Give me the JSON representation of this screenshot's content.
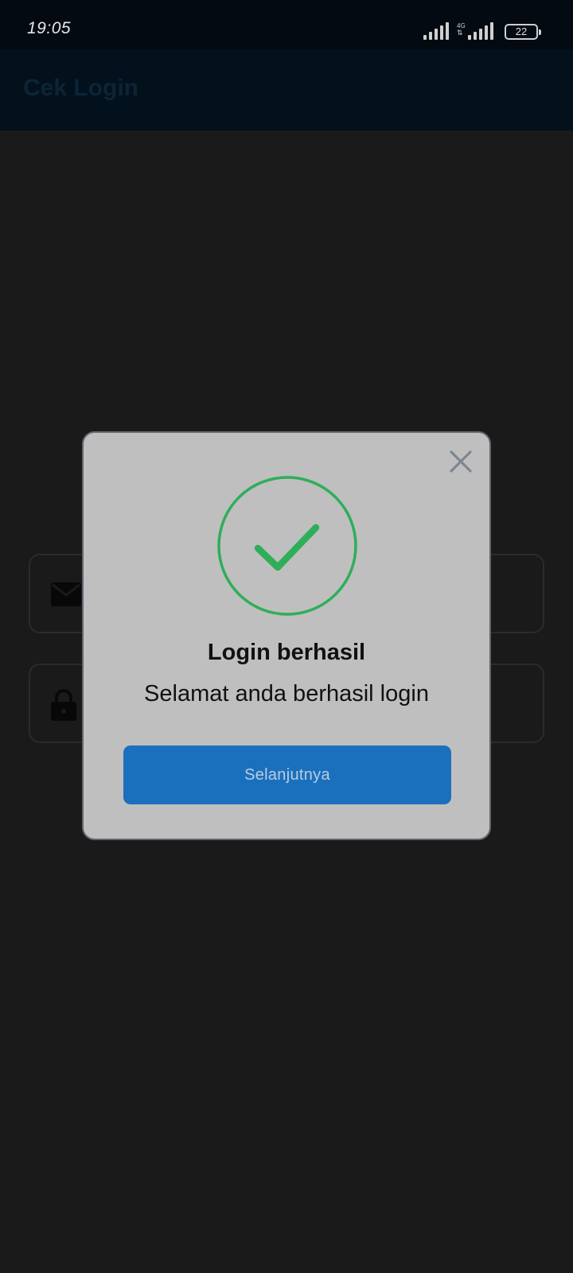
{
  "status_bar": {
    "time": "19:05",
    "network_type": "4G",
    "battery_level": "22",
    "icons": [
      "signal-icon",
      "signal-4g-icon",
      "battery-icon"
    ]
  },
  "app_bar": {
    "title": "Cek Login"
  },
  "form": {
    "email_icon": "email-icon",
    "password_icon": "lock-icon"
  },
  "dialog": {
    "icon": "success-check-icon",
    "title": "Login berhasil",
    "message": "Selamat anda berhasil login",
    "button_label": "Selanjutnya",
    "close_icon": "close-icon"
  },
  "colors": {
    "success": "#2fae5a",
    "button": "#1b70bd",
    "dialog_bg": "#bfbfbf",
    "overlay_bg": "#1a1a1a"
  }
}
